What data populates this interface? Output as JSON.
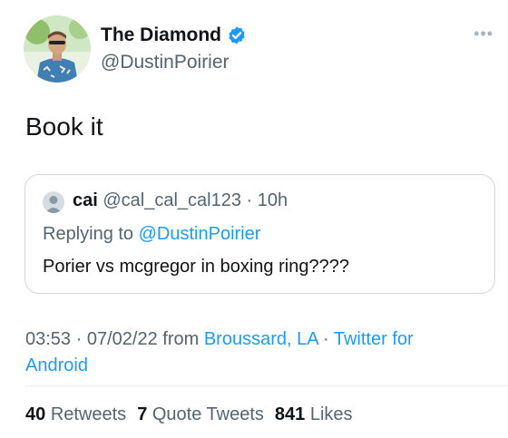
{
  "author": {
    "display_name": "The Diamond",
    "handle": "@DustinPoirier",
    "verified": true,
    "avatar_icon": "profile-photo"
  },
  "menu_icon": "more-dots-icon",
  "tweet": {
    "text": "Book it"
  },
  "quoted_tweet": {
    "display_name": "cai",
    "handle": "@cal_cal_cal123",
    "separator": " · ",
    "age": "10h",
    "replying_prefix": "Replying to ",
    "replying_to": "@DustinPoirier",
    "text": "Porier vs mcgregor in boxing ring????"
  },
  "meta": {
    "time": "03:53",
    "sep1": " · ",
    "date": "07/02/22",
    "from_prefix": " from ",
    "location": "Broussard, LA",
    "sep2": " · ",
    "source": "Twitter for Android"
  },
  "stats": {
    "retweets_count": "40",
    "retweets_label": "Retweets",
    "quotes_count": "7",
    "quotes_label": "Quote Tweets",
    "likes_count": "841",
    "likes_label": "Likes"
  },
  "colors": {
    "accent": "#1d9bf0",
    "secondary_text": "#536471",
    "primary_text": "#0f1419",
    "border": "#cfd9de"
  }
}
